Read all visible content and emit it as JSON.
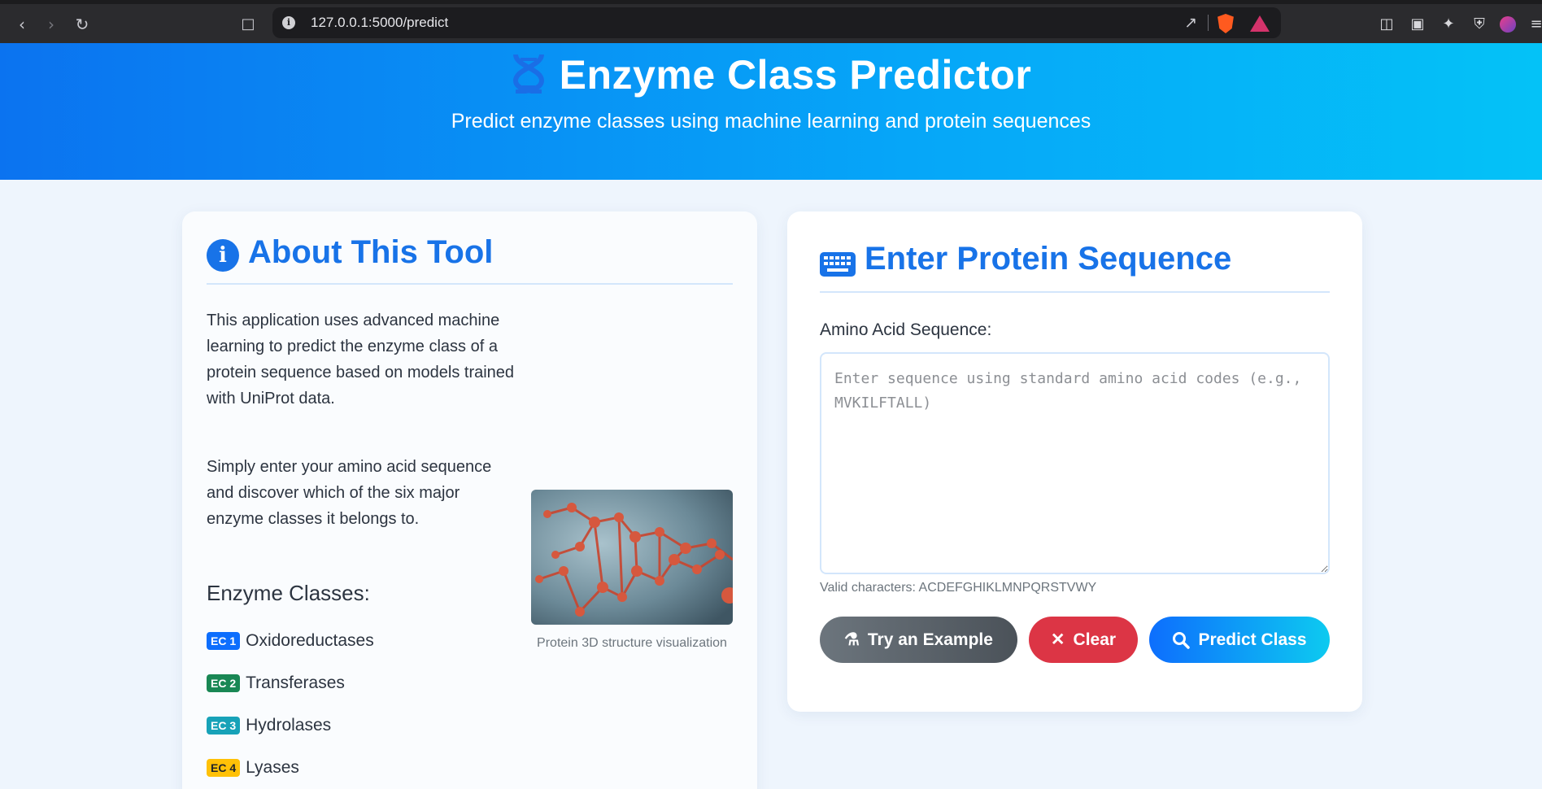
{
  "browser": {
    "url": "127.0.0.1:5000/predict"
  },
  "header": {
    "title": "Enzyme Class Predictor",
    "subtitle": "Predict enzyme classes using machine learning and protein sequences"
  },
  "about": {
    "title": "About This Tool",
    "paragraph1": "This application uses advanced machine learning to predict the enzyme class of a protein sequence based on models trained with UniProt data.",
    "paragraph2": "Simply enter your amino acid sequence and discover which of the six major enzyme classes it belongs to.",
    "classes_heading": "Enzyme Classes:",
    "classes": [
      {
        "badge": "EC 1",
        "name": "Oxidoreductases",
        "color": "#0d6efd"
      },
      {
        "badge": "EC 2",
        "name": "Transferases",
        "color": "#198754"
      },
      {
        "badge": "EC 3",
        "name": "Hydrolases",
        "color": "#17a2b8"
      },
      {
        "badge": "EC 4",
        "name": "Lyases",
        "color": "#ffc107"
      }
    ],
    "image_caption": "Protein 3D structure visualization"
  },
  "sequence": {
    "title": "Enter Protein Sequence",
    "label": "Amino Acid Sequence:",
    "placeholder": "Enter sequence using standard amino acid codes (e.g., MVKILFTALL)",
    "valid_chars": "Valid characters: ACDEFGHIKLMNPQRSTVWY",
    "buttons": {
      "example": "Try an Example",
      "clear": "Clear",
      "predict": "Predict Class"
    }
  },
  "colors": {
    "accent": "#1873e8",
    "danger": "#dc3545",
    "secondary": "#6c757d"
  }
}
